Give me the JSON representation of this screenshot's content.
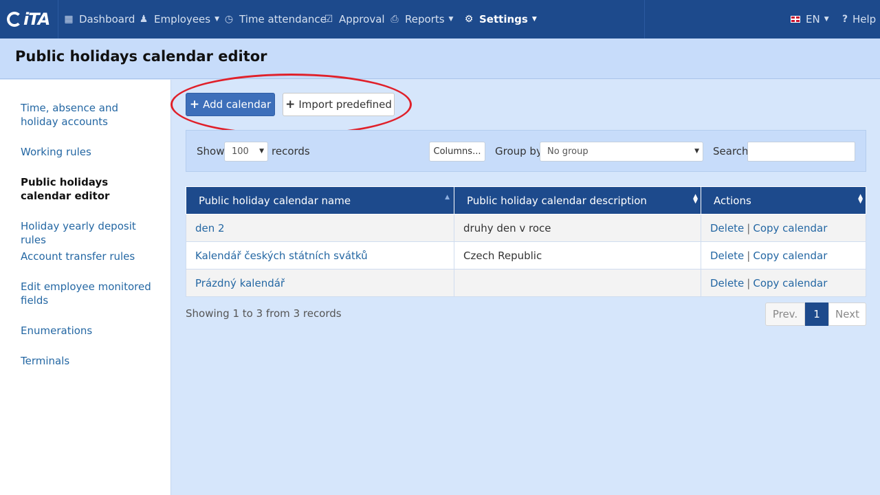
{
  "app": {
    "logo_text": "iTA"
  },
  "nav": {
    "items": [
      {
        "label": "Dashboard",
        "icon": "grid-icon"
      },
      {
        "label": "Employees",
        "icon": "user-icon"
      },
      {
        "label": "Time attendance",
        "icon": "clock-icon"
      },
      {
        "label": "Approval",
        "icon": "check-icon"
      },
      {
        "label": "Reports",
        "icon": "printer-icon"
      },
      {
        "label": "Settings",
        "icon": "gear-icon"
      }
    ],
    "active": "Settings",
    "language": "EN",
    "help": "Help"
  },
  "page": {
    "title": "Public holidays calendar editor"
  },
  "sidebar": {
    "items": [
      {
        "label": "Time, absence and holiday accounts"
      },
      {
        "label": "Working rules"
      },
      {
        "label": "Public holidays calendar editor"
      },
      {
        "label": "Holiday yearly deposit rules"
      },
      {
        "label": "Account transfer rules"
      },
      {
        "label": "Edit employee monitored fields"
      },
      {
        "label": "Enumerations"
      },
      {
        "label": "Terminals"
      }
    ],
    "active": "Public holidays calendar editor"
  },
  "actions": {
    "add_calendar": "Add calendar",
    "import_predefined": "Import predefined"
  },
  "toolbar": {
    "show_label": "Show",
    "records_per_page": "100",
    "records_label": "records",
    "columns_button": "Columns...",
    "group_by_label": "Group by",
    "group_by_value": "No group",
    "search_label": "Search",
    "search_value": ""
  },
  "table": {
    "columns": [
      "Public holiday calendar name",
      "Public holiday calendar description",
      "Actions"
    ],
    "rows": [
      {
        "name": "den 2",
        "description": "druhy den v roce",
        "delete": "Delete",
        "copy": "Copy calendar"
      },
      {
        "name": "Kalendář českých státních svátků",
        "description": "Czech Republic",
        "delete": "Delete",
        "copy": "Copy calendar"
      },
      {
        "name": "Prázdný kalendář",
        "description": "",
        "delete": "Delete",
        "copy": "Copy calendar"
      }
    ],
    "separator": "|"
  },
  "footer": {
    "info": "Showing 1 to 3 from 3 records",
    "prev": "Prev.",
    "current_page": "1",
    "next": "Next"
  },
  "colors": {
    "navbar": "#1d4a8c",
    "accent": "#3d6fba",
    "annotation": "#e0202a"
  }
}
